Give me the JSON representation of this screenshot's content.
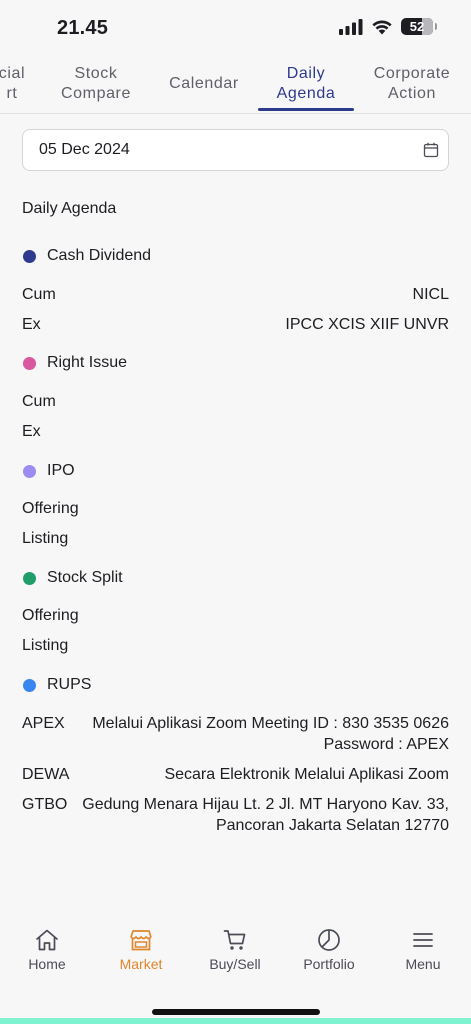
{
  "status": {
    "time": "21.45",
    "battery": "52"
  },
  "tabs": [
    {
      "label": "cial\nrt"
    },
    {
      "label": "Stock\nCompare"
    },
    {
      "label": "Calendar"
    },
    {
      "label": "Daily\nAgenda"
    },
    {
      "label": "Corporate\nAction"
    }
  ],
  "date": {
    "value": "05 Dec 2024"
  },
  "agenda": {
    "title": "Daily Agenda",
    "cash_dividend": {
      "label": "Cash Dividend",
      "color": "#2e3a8c",
      "cum_label": "Cum",
      "cum_value": "NICL",
      "ex_label": "Ex",
      "ex_value": "IPCC XCIS XIIF UNVR"
    },
    "right_issue": {
      "label": "Right Issue",
      "color": "#d9579e",
      "cum_label": "Cum",
      "ex_label": "Ex"
    },
    "ipo": {
      "label": "IPO",
      "color": "#9a8cf0",
      "offering_label": "Offering",
      "listing_label": "Listing"
    },
    "stock_split": {
      "label": "Stock Split",
      "color": "#1f9e6a",
      "offering_label": "Offering",
      "listing_label": "Listing"
    },
    "rups": {
      "label": "RUPS",
      "color": "#3a86f0",
      "items": [
        {
          "code": "APEX",
          "line1": "Melalui Aplikasi Zoom Meeting ID : 830 3535 0626",
          "line2": "Password : APEX"
        },
        {
          "code": "DEWA",
          "line1": "Secara Elektronik Melalui Aplikasi Zoom",
          "line2": ""
        },
        {
          "code": "GTBO",
          "line1": "Gedung Menara Hijau Lt. 2 Jl. MT Haryono Kav. 33,",
          "line2": "Pancoran Jakarta Selatan 12770"
        }
      ]
    }
  },
  "nav": [
    {
      "label": "Home",
      "icon": "home-icon"
    },
    {
      "label": "Market",
      "icon": "market-icon"
    },
    {
      "label": "Buy/Sell",
      "icon": "cart-icon"
    },
    {
      "label": "Portfolio",
      "icon": "pie-icon"
    },
    {
      "label": "Menu",
      "icon": "menu-icon"
    }
  ],
  "colors": {
    "accent": "#2e3a8c",
    "nav_active": "#e0862d"
  }
}
